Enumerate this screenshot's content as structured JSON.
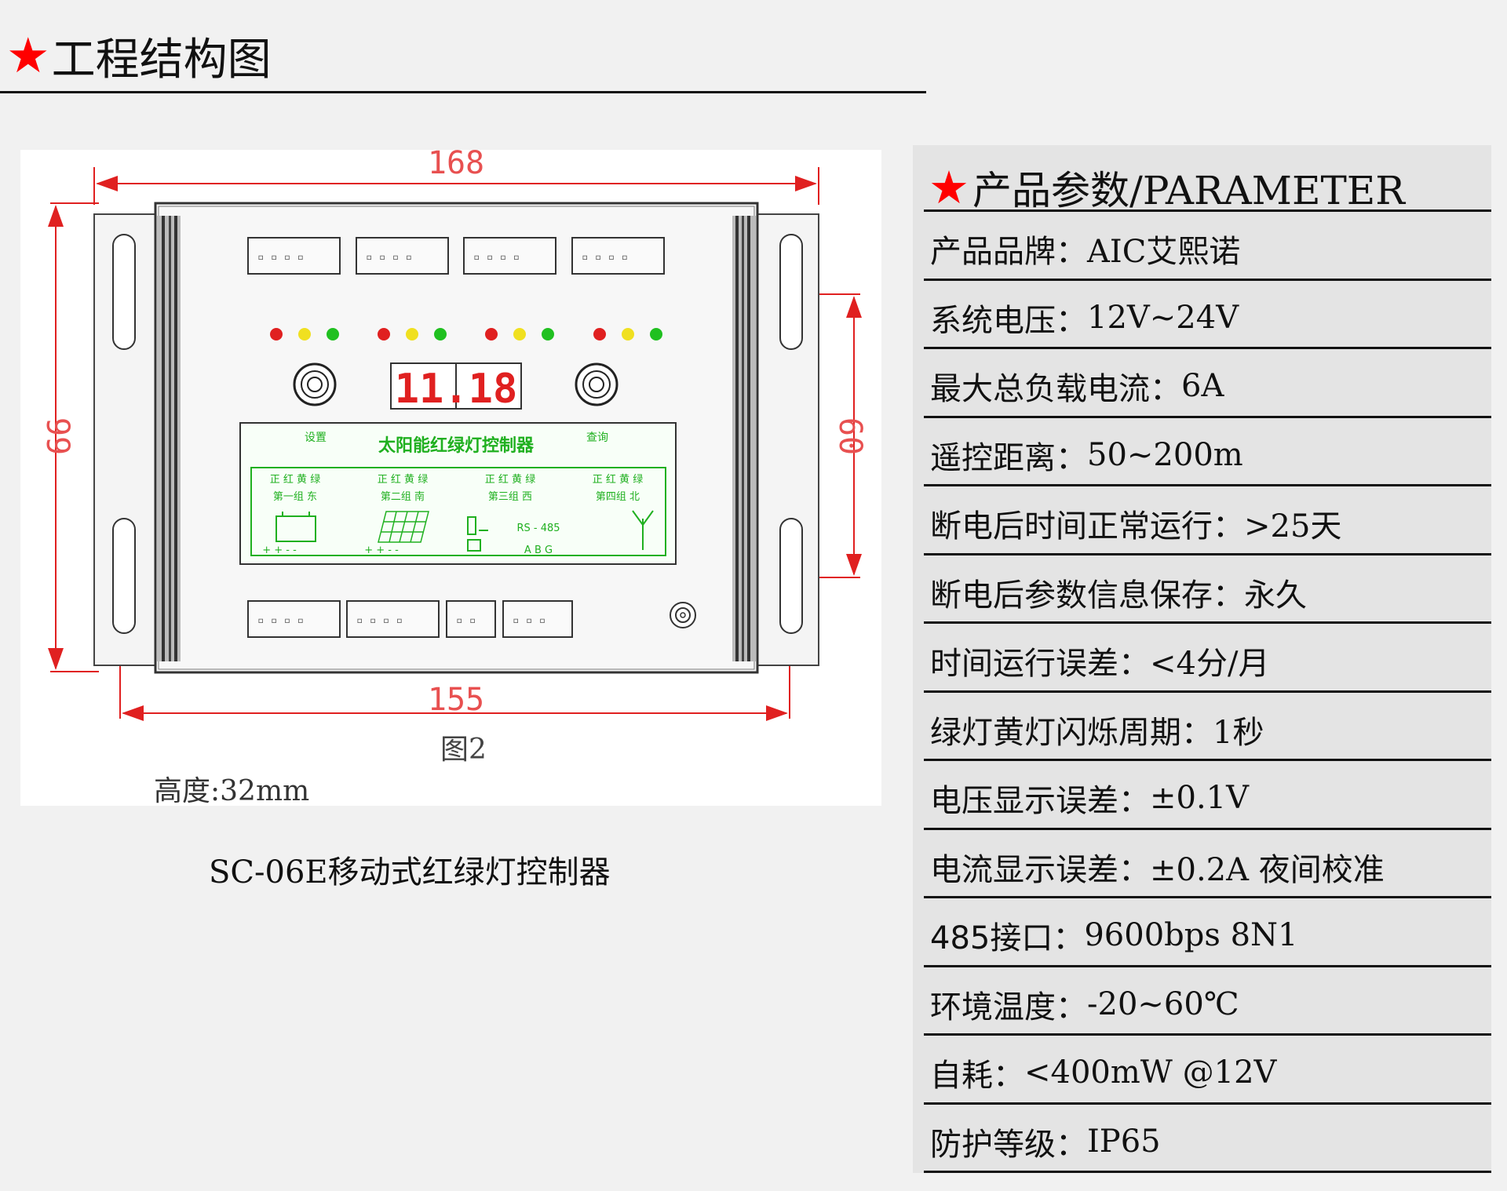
{
  "header": {
    "title": "工程结构图"
  },
  "drawing": {
    "dim_top": "168",
    "dim_bottom": "155",
    "dim_left": "99",
    "dim_right": "60",
    "figure_label": "图2",
    "height_label": "高度:32mm",
    "device_title": "太阳能红绿灯控制器",
    "button_left": "设置",
    "button_right": "查询",
    "display": "11.18",
    "group_head": "正 红 黄 绿",
    "groups": [
      "第一组 东",
      "第二组 南",
      "第三组 西",
      "第四组 北"
    ],
    "rs485": "RS - 485",
    "abg": "A  B  G",
    "terminals": "+ +  -  -"
  },
  "caption": "SC-06E移动式红绿灯控制器",
  "parameters": {
    "title": "产品参数/PARAMETER",
    "rows": [
      {
        "label": "产品品牌：",
        "value": "AIC艾熙诺"
      },
      {
        "label": "系统电压：",
        "value": "12V~24V"
      },
      {
        "label": "最大总负载电流：",
        "value": "6A"
      },
      {
        "label": "遥控距离：",
        "value": "50~200m"
      },
      {
        "label": "断电后时间正常运行：",
        "value": ">25天"
      },
      {
        "label": "断电后参数信息保存：",
        "value": "永久"
      },
      {
        "label": "时间运行误差：",
        "value": "<4分/月"
      },
      {
        "label": "绿灯黄灯闪烁周期：",
        "value": "1秒"
      },
      {
        "label": "电压显示误差：",
        "value": "±0.1V"
      },
      {
        "label": "电流显示误差：",
        "value": "±0.2A 夜间校准"
      },
      {
        "label": "485接口：",
        "value": "9600bps  8N1"
      },
      {
        "label": "环境温度：",
        "value": "-20~60℃"
      },
      {
        "label": "自耗：",
        "value": "<400mW @12V"
      },
      {
        "label": "防护等级：",
        "value": "IP65"
      }
    ]
  }
}
